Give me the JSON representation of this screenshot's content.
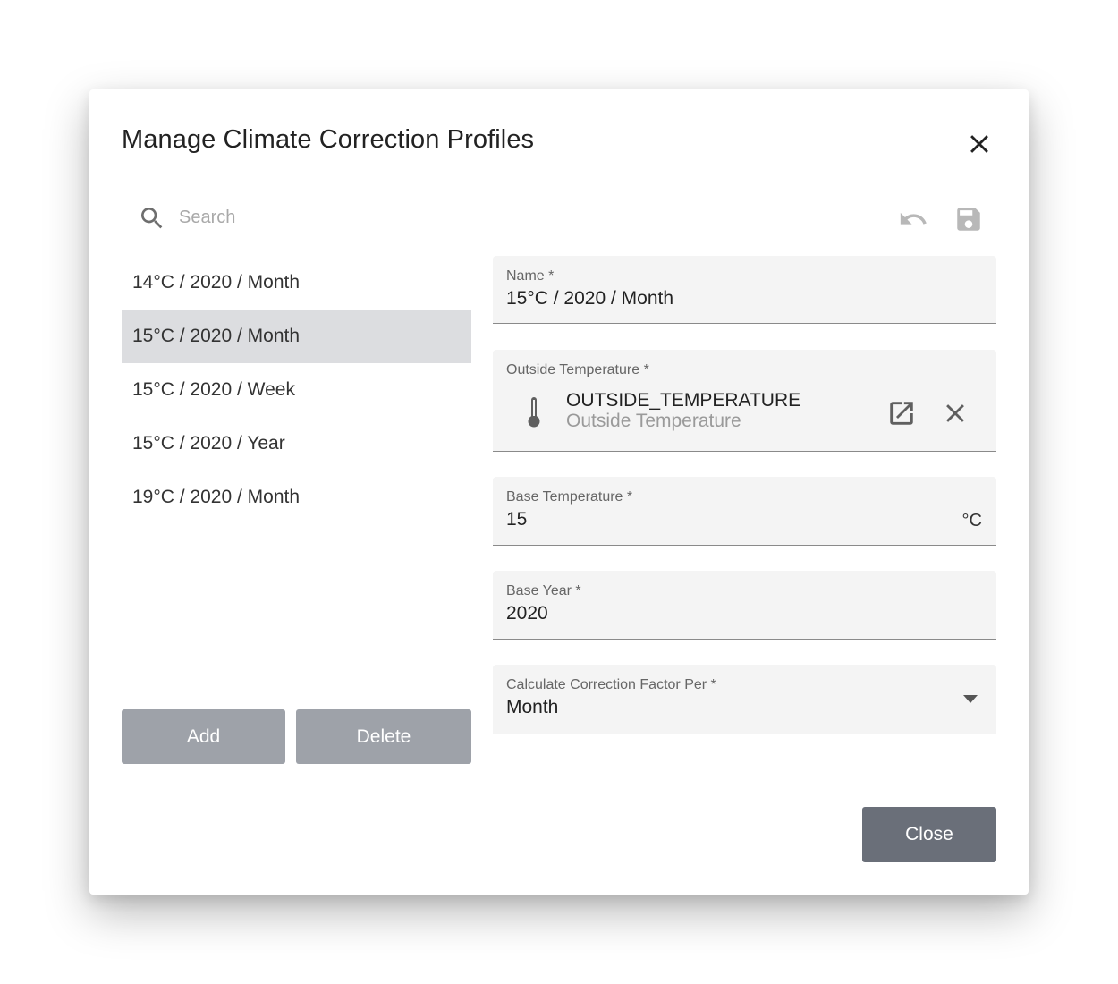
{
  "dialog": {
    "title": "Manage Climate Correction Profiles"
  },
  "search": {
    "placeholder": "Search",
    "value": ""
  },
  "icons": {
    "close": "close-icon",
    "search": "search-icon",
    "undo": "undo-icon",
    "save": "save-icon",
    "thermometer": "thermometer-icon",
    "open_external": "open-in-new-icon",
    "clear": "clear-icon",
    "dropdown": "arrow-drop-down-icon"
  },
  "profiles": {
    "items": [
      {
        "label": "14°C / 2020 / Month"
      },
      {
        "label": "15°C / 2020 / Month",
        "selected": true
      },
      {
        "label": "15°C / 2020 / Week"
      },
      {
        "label": "15°C / 2020 / Year"
      },
      {
        "label": "19°C / 2020 / Month"
      }
    ]
  },
  "buttons": {
    "add": "Add",
    "delete": "Delete",
    "close": "Close"
  },
  "form": {
    "name": {
      "label": "Name *",
      "value": "15°C / 2020 / Month"
    },
    "outside_temperature": {
      "label": "Outside Temperature *",
      "sensor_name": "OUTSIDE_TEMPERATURE",
      "sensor_description": "Outside Temperature"
    },
    "base_temperature": {
      "label": "Base Temperature *",
      "value": "15",
      "unit": "°C"
    },
    "base_year": {
      "label": "Base Year *",
      "value": "2020"
    },
    "calculate_per": {
      "label": "Calculate Correction Factor Per *",
      "value": "Month"
    }
  },
  "colors": {
    "selected_row": "#dcdde0",
    "secondary_button": "#9ea2a9",
    "primary_button": "#6a6f79",
    "field_background": "#f4f4f4",
    "icon_disabled": "#b8b8b8"
  }
}
